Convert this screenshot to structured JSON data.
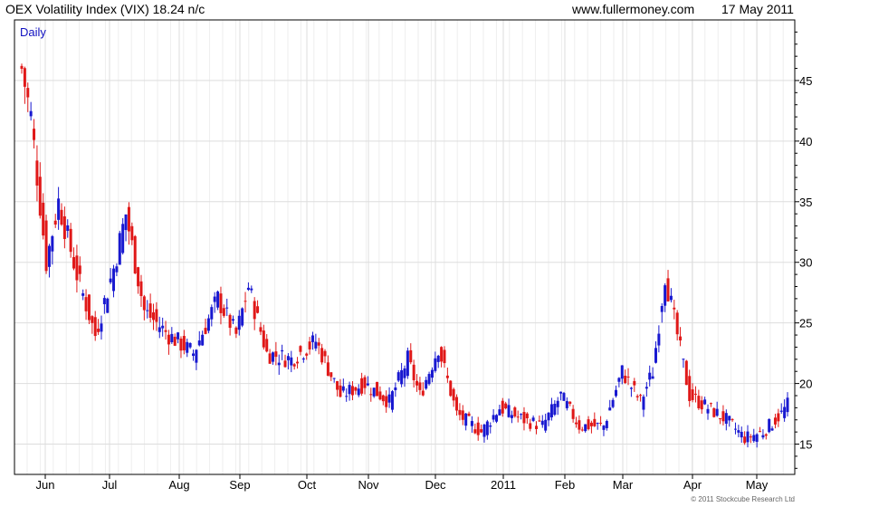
{
  "header": {
    "title": "OEX Volatility Index (VIX) 18.24 n/c",
    "site": "www.fullermoney.com",
    "date": "17 May 2011"
  },
  "chart_data": {
    "type": "candlestick",
    "period_label": "Daily",
    "copyright": "© 2011 Stockcube Research Ltd",
    "ylim": [
      12.5,
      50
    ],
    "yticks": [
      15,
      20,
      25,
      30,
      35,
      40,
      45
    ],
    "xticks": [
      "Jun",
      "Jul",
      "Aug",
      "Sep",
      "Oct",
      "Nov",
      "Dec",
      "2011",
      "Feb",
      "Mar",
      "Apr",
      "May"
    ],
    "grid": true,
    "colors": {
      "up": "#1818d0",
      "down": "#e01818",
      "grid": "#dddddd"
    },
    "series": [
      {
        "key_points": [
          {
            "i": 0,
            "v": 46
          },
          {
            "i": 3,
            "v": 42
          },
          {
            "i": 8,
            "v": 30
          },
          {
            "i": 12,
            "v": 35
          },
          {
            "i": 18,
            "v": 29
          },
          {
            "i": 24,
            "v": 24
          },
          {
            "i": 30,
            "v": 29.5
          },
          {
            "i": 34,
            "v": 34
          },
          {
            "i": 40,
            "v": 26
          },
          {
            "i": 48,
            "v": 24
          },
          {
            "i": 56,
            "v": 22.5
          },
          {
            "i": 64,
            "v": 27
          },
          {
            "i": 70,
            "v": 24
          },
          {
            "i": 74,
            "v": 28
          },
          {
            "i": 80,
            "v": 22.5
          },
          {
            "i": 88,
            "v": 22
          },
          {
            "i": 96,
            "v": 23.5
          },
          {
            "i": 104,
            "v": 19
          },
          {
            "i": 112,
            "v": 20
          },
          {
            "i": 120,
            "v": 18.5
          },
          {
            "i": 126,
            "v": 22
          },
          {
            "i": 130,
            "v": 19
          },
          {
            "i": 136,
            "v": 23
          },
          {
            "i": 142,
            "v": 17.5
          },
          {
            "i": 150,
            "v": 16
          },
          {
            "i": 156,
            "v": 18
          },
          {
            "i": 164,
            "v": 17
          },
          {
            "i": 170,
            "v": 16.5
          },
          {
            "i": 176,
            "v": 19
          },
          {
            "i": 182,
            "v": 16.5
          },
          {
            "i": 190,
            "v": 16.5
          },
          {
            "i": 196,
            "v": 21
          },
          {
            "i": 202,
            "v": 18.5
          },
          {
            "i": 206,
            "v": 21
          },
          {
            "i": 210,
            "v": 29
          },
          {
            "i": 214,
            "v": 24
          },
          {
            "i": 218,
            "v": 19
          },
          {
            "i": 224,
            "v": 18
          },
          {
            "i": 230,
            "v": 17
          },
          {
            "i": 236,
            "v": 15.5
          },
          {
            "i": 242,
            "v": 16
          },
          {
            "i": 248,
            "v": 17.5
          },
          {
            "i": 250,
            "v": 18.24
          }
        ]
      }
    ]
  }
}
